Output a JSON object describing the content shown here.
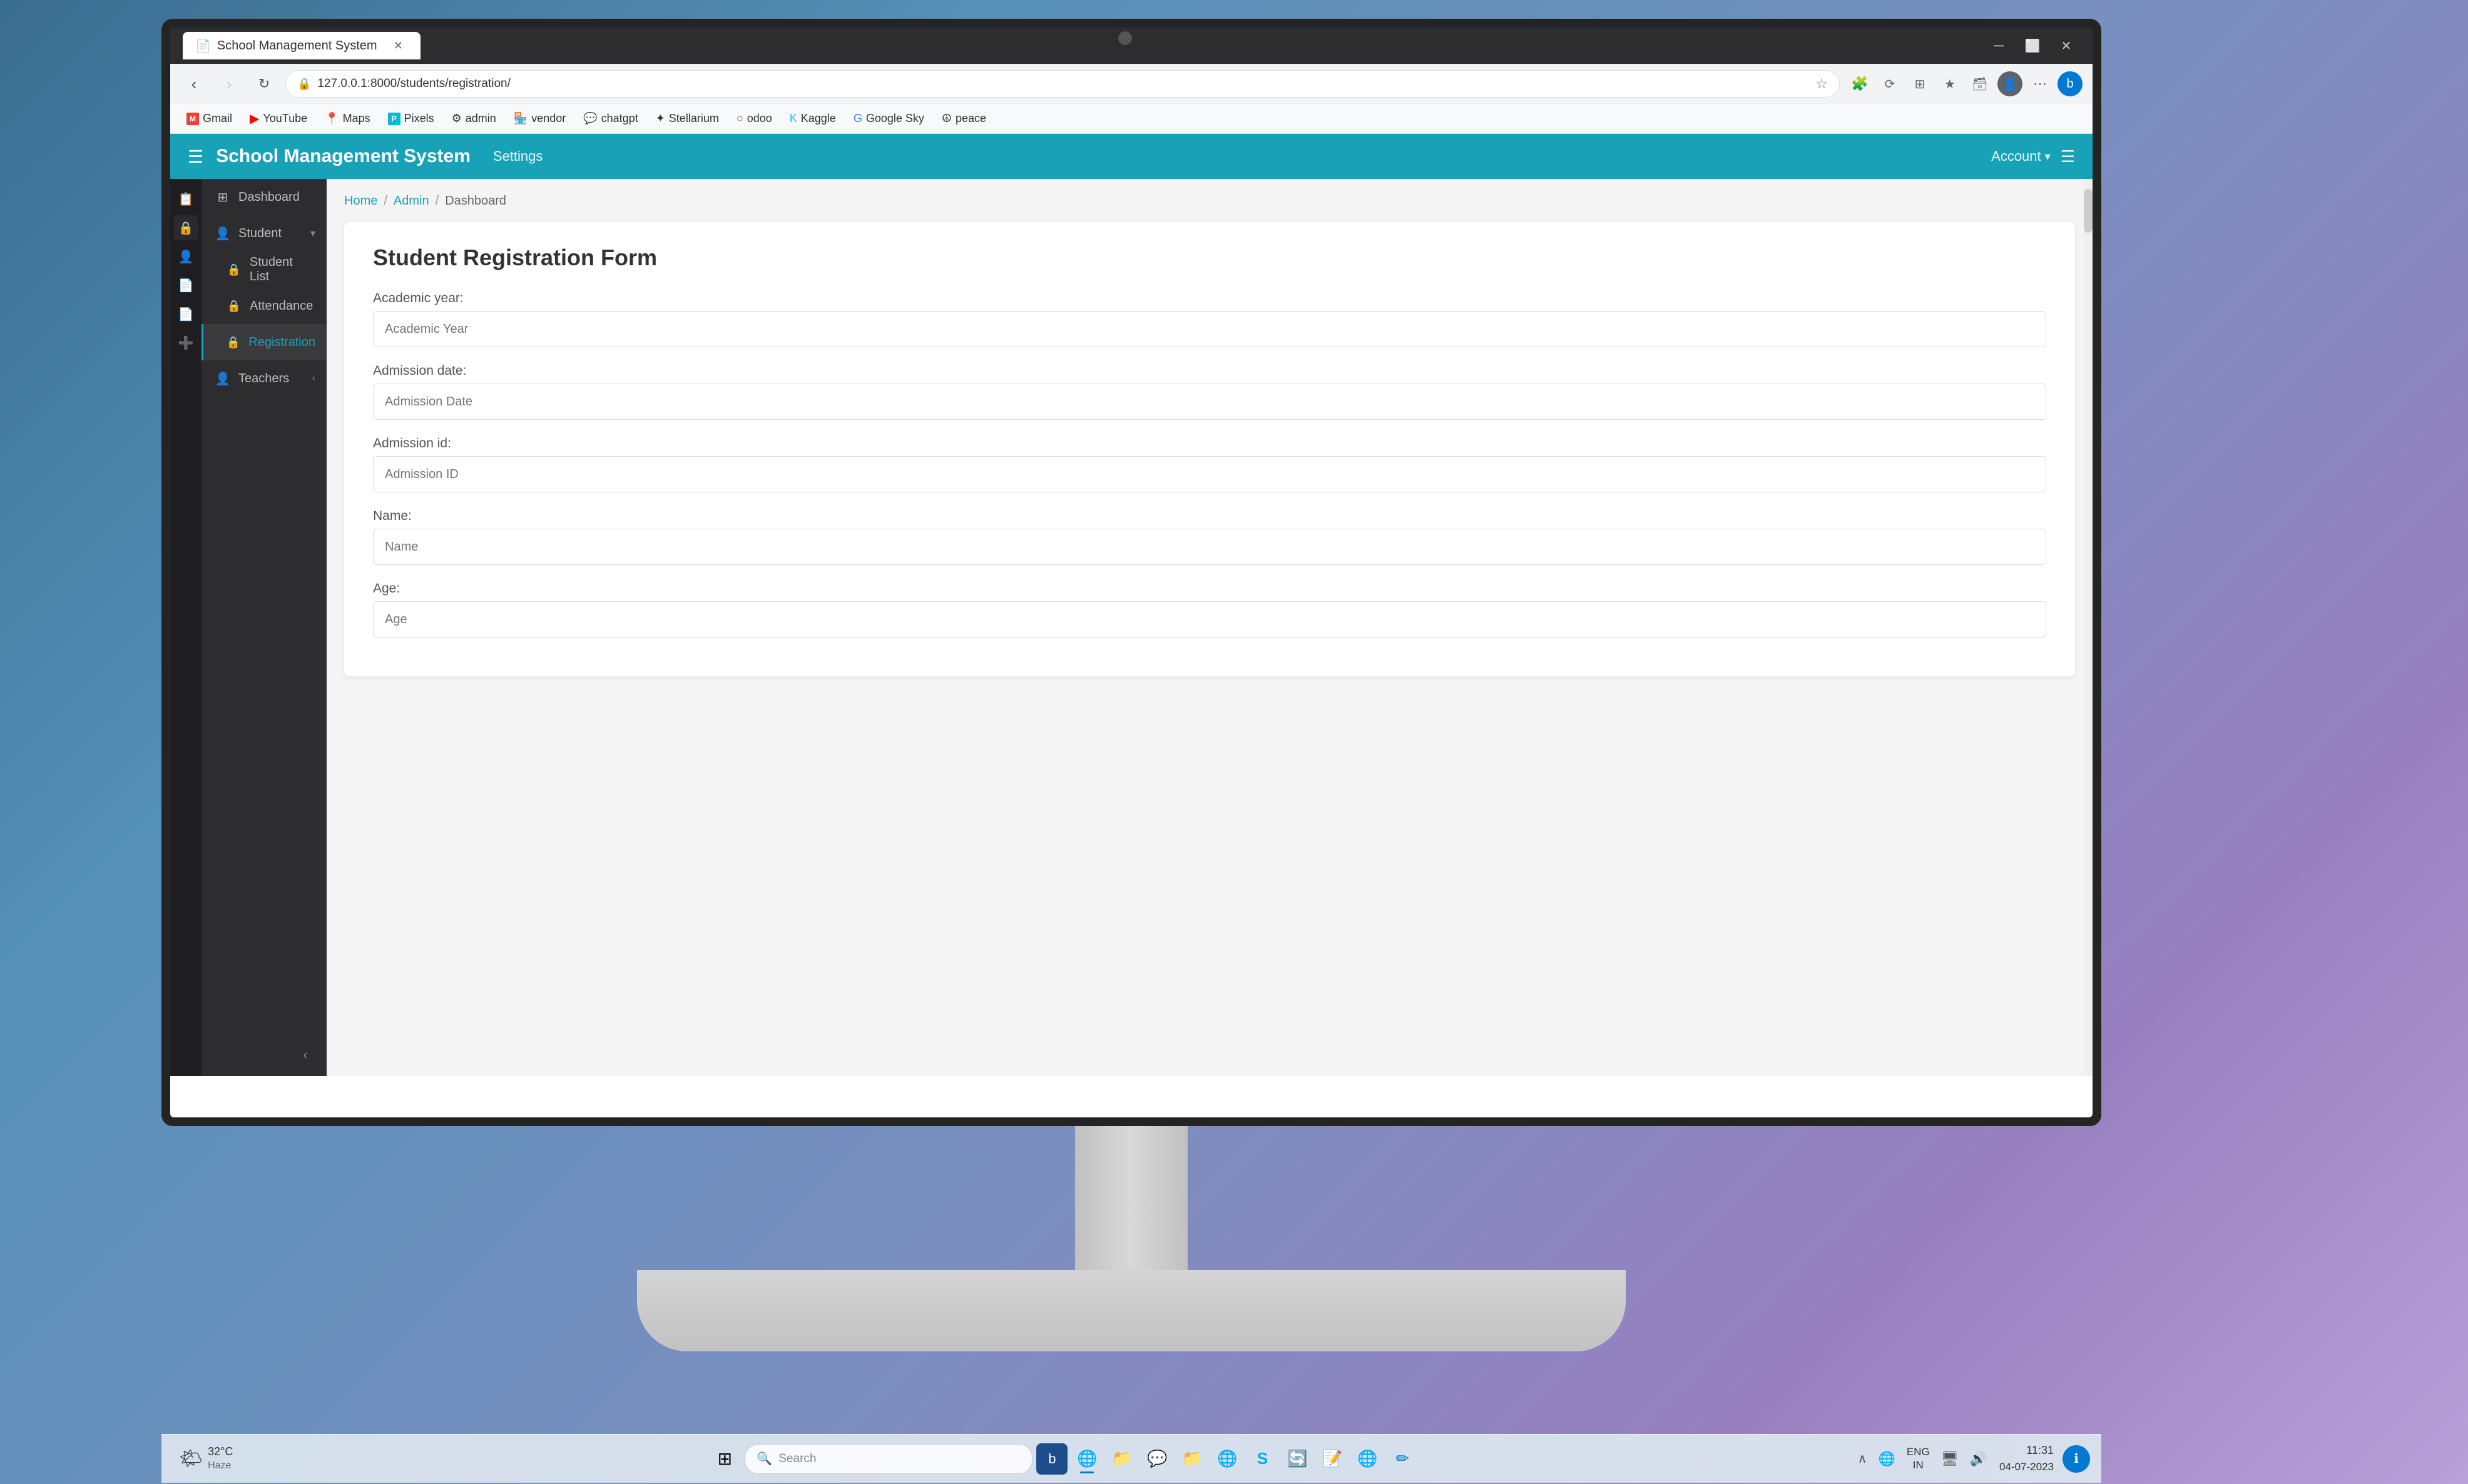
{
  "monitor": {
    "webcam_alt": "webcam"
  },
  "browser": {
    "tab_title": "School Management System",
    "tab_icon": "📄",
    "url": "127.0.0.1:8000/students/registration/",
    "url_full": "⚪ 127.0.0.1:8000/students/registration/"
  },
  "bookmarks": [
    {
      "label": "Gmail",
      "icon": "M",
      "color": "#EA4335",
      "bg": "#fff"
    },
    {
      "label": "YouTube",
      "icon": "▶",
      "color": "#FF0000",
      "bg": "#fff"
    },
    {
      "label": "Maps",
      "icon": "📍",
      "color": "#4285F4",
      "bg": "#fff"
    },
    {
      "label": "Pixels",
      "icon": "P",
      "color": "#00BCD4",
      "bg": "#00BCD4"
    },
    {
      "label": "admin",
      "icon": "⚙",
      "color": "#fff",
      "bg": "#555"
    },
    {
      "label": "vendor",
      "icon": "🏪",
      "color": "#333",
      "bg": "#fff"
    },
    {
      "label": "chatgpt",
      "icon": "💬",
      "color": "#10a37f",
      "bg": "#fff"
    },
    {
      "label": "Stellarium",
      "icon": "✦",
      "color": "#fff",
      "bg": "#1a1a3e"
    },
    {
      "label": "odoo",
      "icon": "○",
      "color": "#714B67",
      "bg": "#fff"
    },
    {
      "label": "Kaggle",
      "icon": "K",
      "color": "#20BEFF",
      "bg": "#fff"
    },
    {
      "label": "Google Sky",
      "icon": "G",
      "color": "#4285F4",
      "bg": "#fff"
    },
    {
      "label": "peace",
      "icon": "☮",
      "color": "#333",
      "bg": "#fff"
    }
  ],
  "app": {
    "title": "School Management System",
    "settings_label": "Settings",
    "account_label": "Account"
  },
  "sidebar_icons": [
    "📋",
    "🔒",
    "👤",
    "📄",
    "📄",
    "➕"
  ],
  "sidebar": {
    "items": [
      {
        "label": "Dashboard",
        "icon": "⊞",
        "active": false
      },
      {
        "label": "Student",
        "icon": "👤",
        "active": false,
        "has_arrow": true
      },
      {
        "label": "Student List",
        "icon": "🔒",
        "active": false
      },
      {
        "label": "Attendance",
        "icon": "🔒",
        "active": false
      },
      {
        "label": "Registration",
        "icon": "🔒",
        "active": true
      },
      {
        "label": "Teachers",
        "icon": "👤",
        "active": false,
        "has_arrow": true
      }
    ]
  },
  "breadcrumb": {
    "home": "Home",
    "admin": "Admin",
    "dashboard": "Dashboard"
  },
  "form": {
    "title": "Student Registration Form",
    "fields": [
      {
        "label": "Academic year:",
        "placeholder": "Academic Year",
        "name": "academic-year-input"
      },
      {
        "label": "Admission date:",
        "placeholder": "Admission Date",
        "name": "admission-date-input"
      },
      {
        "label": "Admission id:",
        "placeholder": "Admission ID",
        "name": "admission-id-input"
      },
      {
        "label": "Name:",
        "placeholder": "Name",
        "name": "name-input"
      },
      {
        "label": "Age:",
        "placeholder": "Age",
        "name": "age-input"
      }
    ]
  },
  "taskbar": {
    "weather_icon": "🌤",
    "temperature": "32°C",
    "condition": "Haze",
    "search_placeholder": "Search",
    "time": "11:31",
    "date": "04-07-2023",
    "lang": "ENG\nIN",
    "apps": [
      {
        "icon": "🪟",
        "name": "windows-start",
        "active": false
      },
      {
        "icon": "🔍",
        "name": "search-app",
        "active": false
      },
      {
        "icon": "🌐",
        "name": "edge-icon",
        "bg": "#0078d4",
        "active": true
      },
      {
        "icon": "📁",
        "name": "file-explorer",
        "active": false
      },
      {
        "icon": "💬",
        "name": "teams-app",
        "active": false
      },
      {
        "icon": "📁",
        "name": "folder-app",
        "active": false
      },
      {
        "icon": "🌐",
        "name": "chrome-app",
        "active": false
      },
      {
        "icon": "S",
        "name": "skype-app",
        "active": false
      },
      {
        "icon": "🔄",
        "name": "refresh-app",
        "active": false
      },
      {
        "icon": "📝",
        "name": "notes-app",
        "active": false
      },
      {
        "icon": "🌐",
        "name": "edge-app2",
        "active": false
      },
      {
        "icon": "✏",
        "name": "vscode-app",
        "active": false
      }
    ]
  }
}
